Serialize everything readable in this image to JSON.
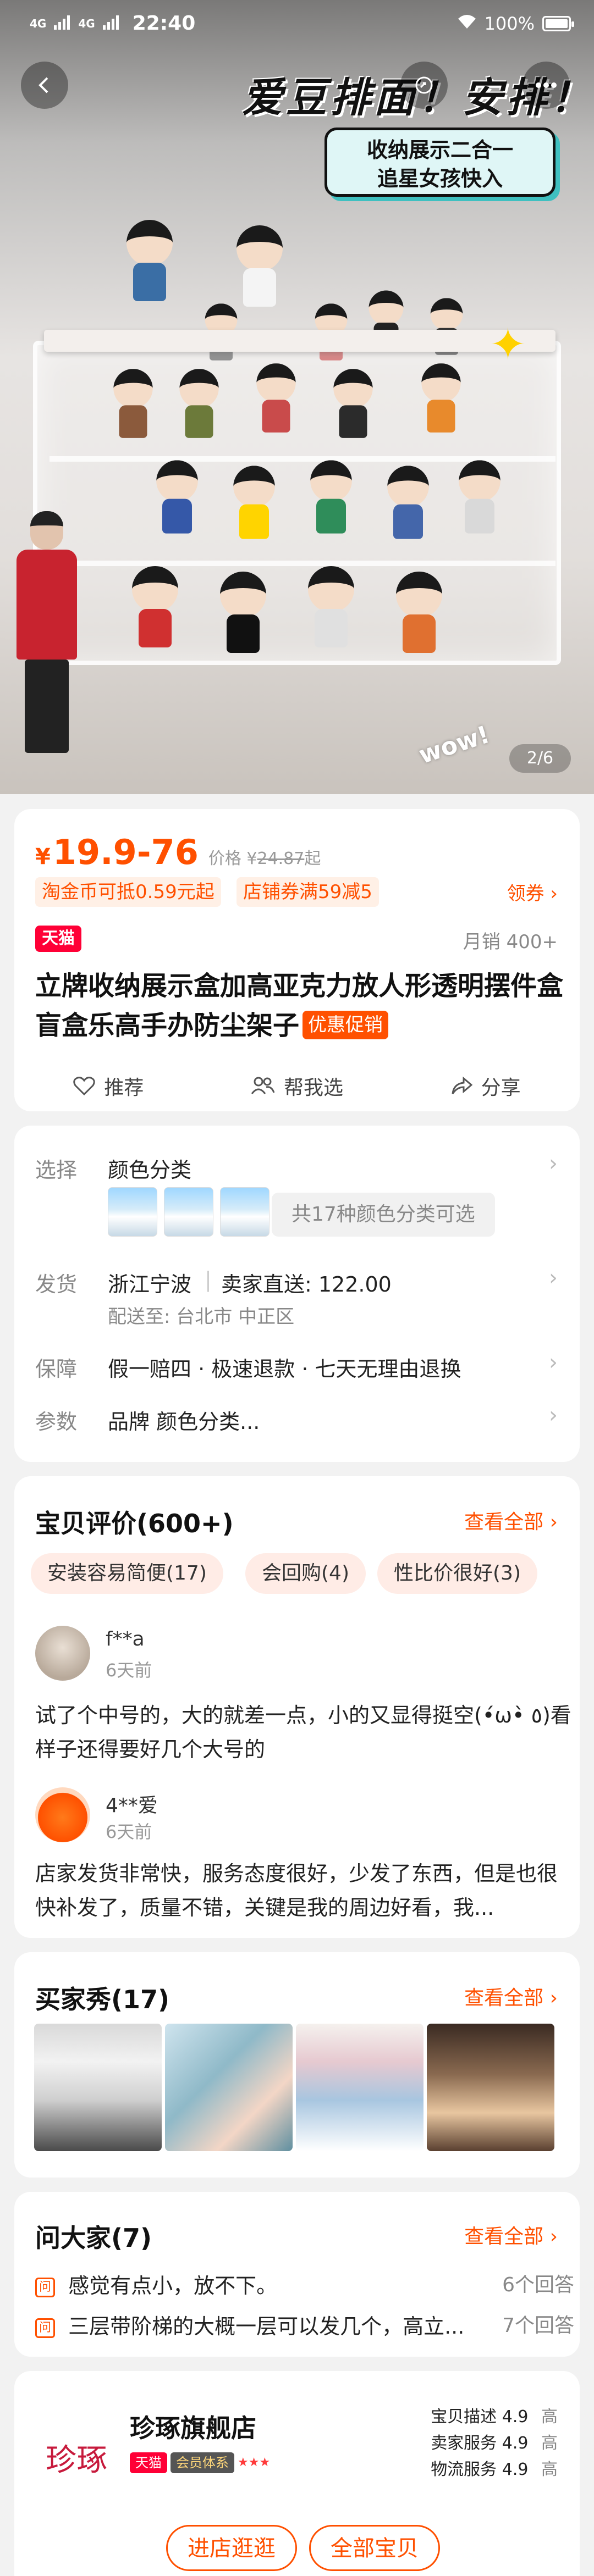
{
  "status": {
    "signal1": "4G",
    "signal2": "4G",
    "time": "22:40",
    "battery": "100%"
  },
  "hero": {
    "title": "爱豆排面！安排！",
    "subtitle_line1": "收纳展示二合一",
    "subtitle_line2": "追星女孩快入",
    "wow": "wow!",
    "counter": "2/6"
  },
  "product": {
    "price_symbol": "¥",
    "price": "19.9-76",
    "price_label": "价格 ¥",
    "original_price": "24.87",
    "original_suffix": "起",
    "coupon1": "淘金币可抵0.59元起",
    "coupon2": "店铺券满59减5",
    "coupon_link": "领券",
    "tmall": "天猫",
    "monthly_sales": "月销 400+",
    "title": "立牌收纳展示盒加高亚克力放人形透明摆件盒盲盒乐高手办防尘架子",
    "promo": "优惠促销",
    "actions": [
      {
        "label": "推荐"
      },
      {
        "label": "帮我选"
      },
      {
        "label": "分享"
      }
    ]
  },
  "specs": {
    "select_label": "选择",
    "select_value": "颜色分类",
    "more_colors": "共17种颜色分类可选",
    "ship_label": "发货",
    "ship_origin": "浙江宁波",
    "ship_seller": "卖家直送: 122.00",
    "ship_to": "配送至: 台北市 中正区",
    "guarantee_label": "保障",
    "guarantee_value": "假一赔四 · 极速退款 · 七天无理由退换",
    "params_label": "参数",
    "params_value": "品牌 颜色分类..."
  },
  "reviews": {
    "title": "宝贝评价(600+)",
    "see_all": "查看全部",
    "tags": [
      "安装容易简便(17)",
      "会回购(4)",
      "性比价很好(3)"
    ],
    "items": [
      {
        "name": "f**a",
        "time": "6天前",
        "text": "试了个中号的，大的就差一点，小的又显得挺空(•́ω•̀ ٥)看样子还得要好几个大号的"
      },
      {
        "name": "4**爱",
        "time": "6天前",
        "text": "店家发货非常快，服务态度很好，少发了东西，但是也很快补发了，质量不错，关键是我的周边好看，我..."
      }
    ]
  },
  "buyer_show": {
    "title": "买家秀(17)",
    "see_all": "查看全部"
  },
  "qa": {
    "title": "问大家(7)",
    "see_all": "查看全部",
    "icon": "问",
    "items": [
      {
        "q": "感觉有点小，放不下。",
        "count": "6个回答"
      },
      {
        "q": "三层带阶梯的大概一层可以发几个，高立...",
        "count": "7个回答"
      }
    ]
  },
  "shop": {
    "logo": "珍琢",
    "name": "珍琢旗舰店",
    "badge_tmall": "天猫",
    "badge_member": "会员体系",
    "stars": "★★★",
    "ratings": [
      {
        "label": "宝贝描述",
        "score": "4.9",
        "level": "高"
      },
      {
        "label": "卖家服务",
        "score": "4.9",
        "level": "高"
      },
      {
        "label": "物流服务",
        "score": "4.9",
        "level": "高"
      }
    ],
    "btn_visit": "进店逛逛",
    "btn_all": "全部宝贝"
  },
  "colors": {
    "accent": "#ff5000",
    "tmall_red": "#ff0036"
  }
}
